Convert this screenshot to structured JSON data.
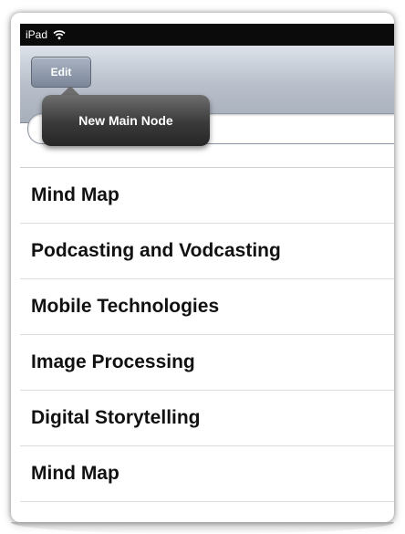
{
  "status_bar": {
    "device_label": "iPad",
    "wifi_icon": "wifi-icon"
  },
  "nav_bar": {
    "edit_label": "Edit"
  },
  "popover": {
    "label": "New Main Node"
  },
  "list": {
    "items": [
      {
        "label": "Mind Map"
      },
      {
        "label": "Podcasting and Vodcasting"
      },
      {
        "label": "Mobile Technologies"
      },
      {
        "label": "Image Processing"
      },
      {
        "label": "Digital Storytelling"
      },
      {
        "label": "Mind Map"
      }
    ]
  },
  "colors": {
    "status_bar": "#0b0b0b",
    "nav_bar": "#b9c0cb",
    "popover": "#3a3a3a"
  }
}
